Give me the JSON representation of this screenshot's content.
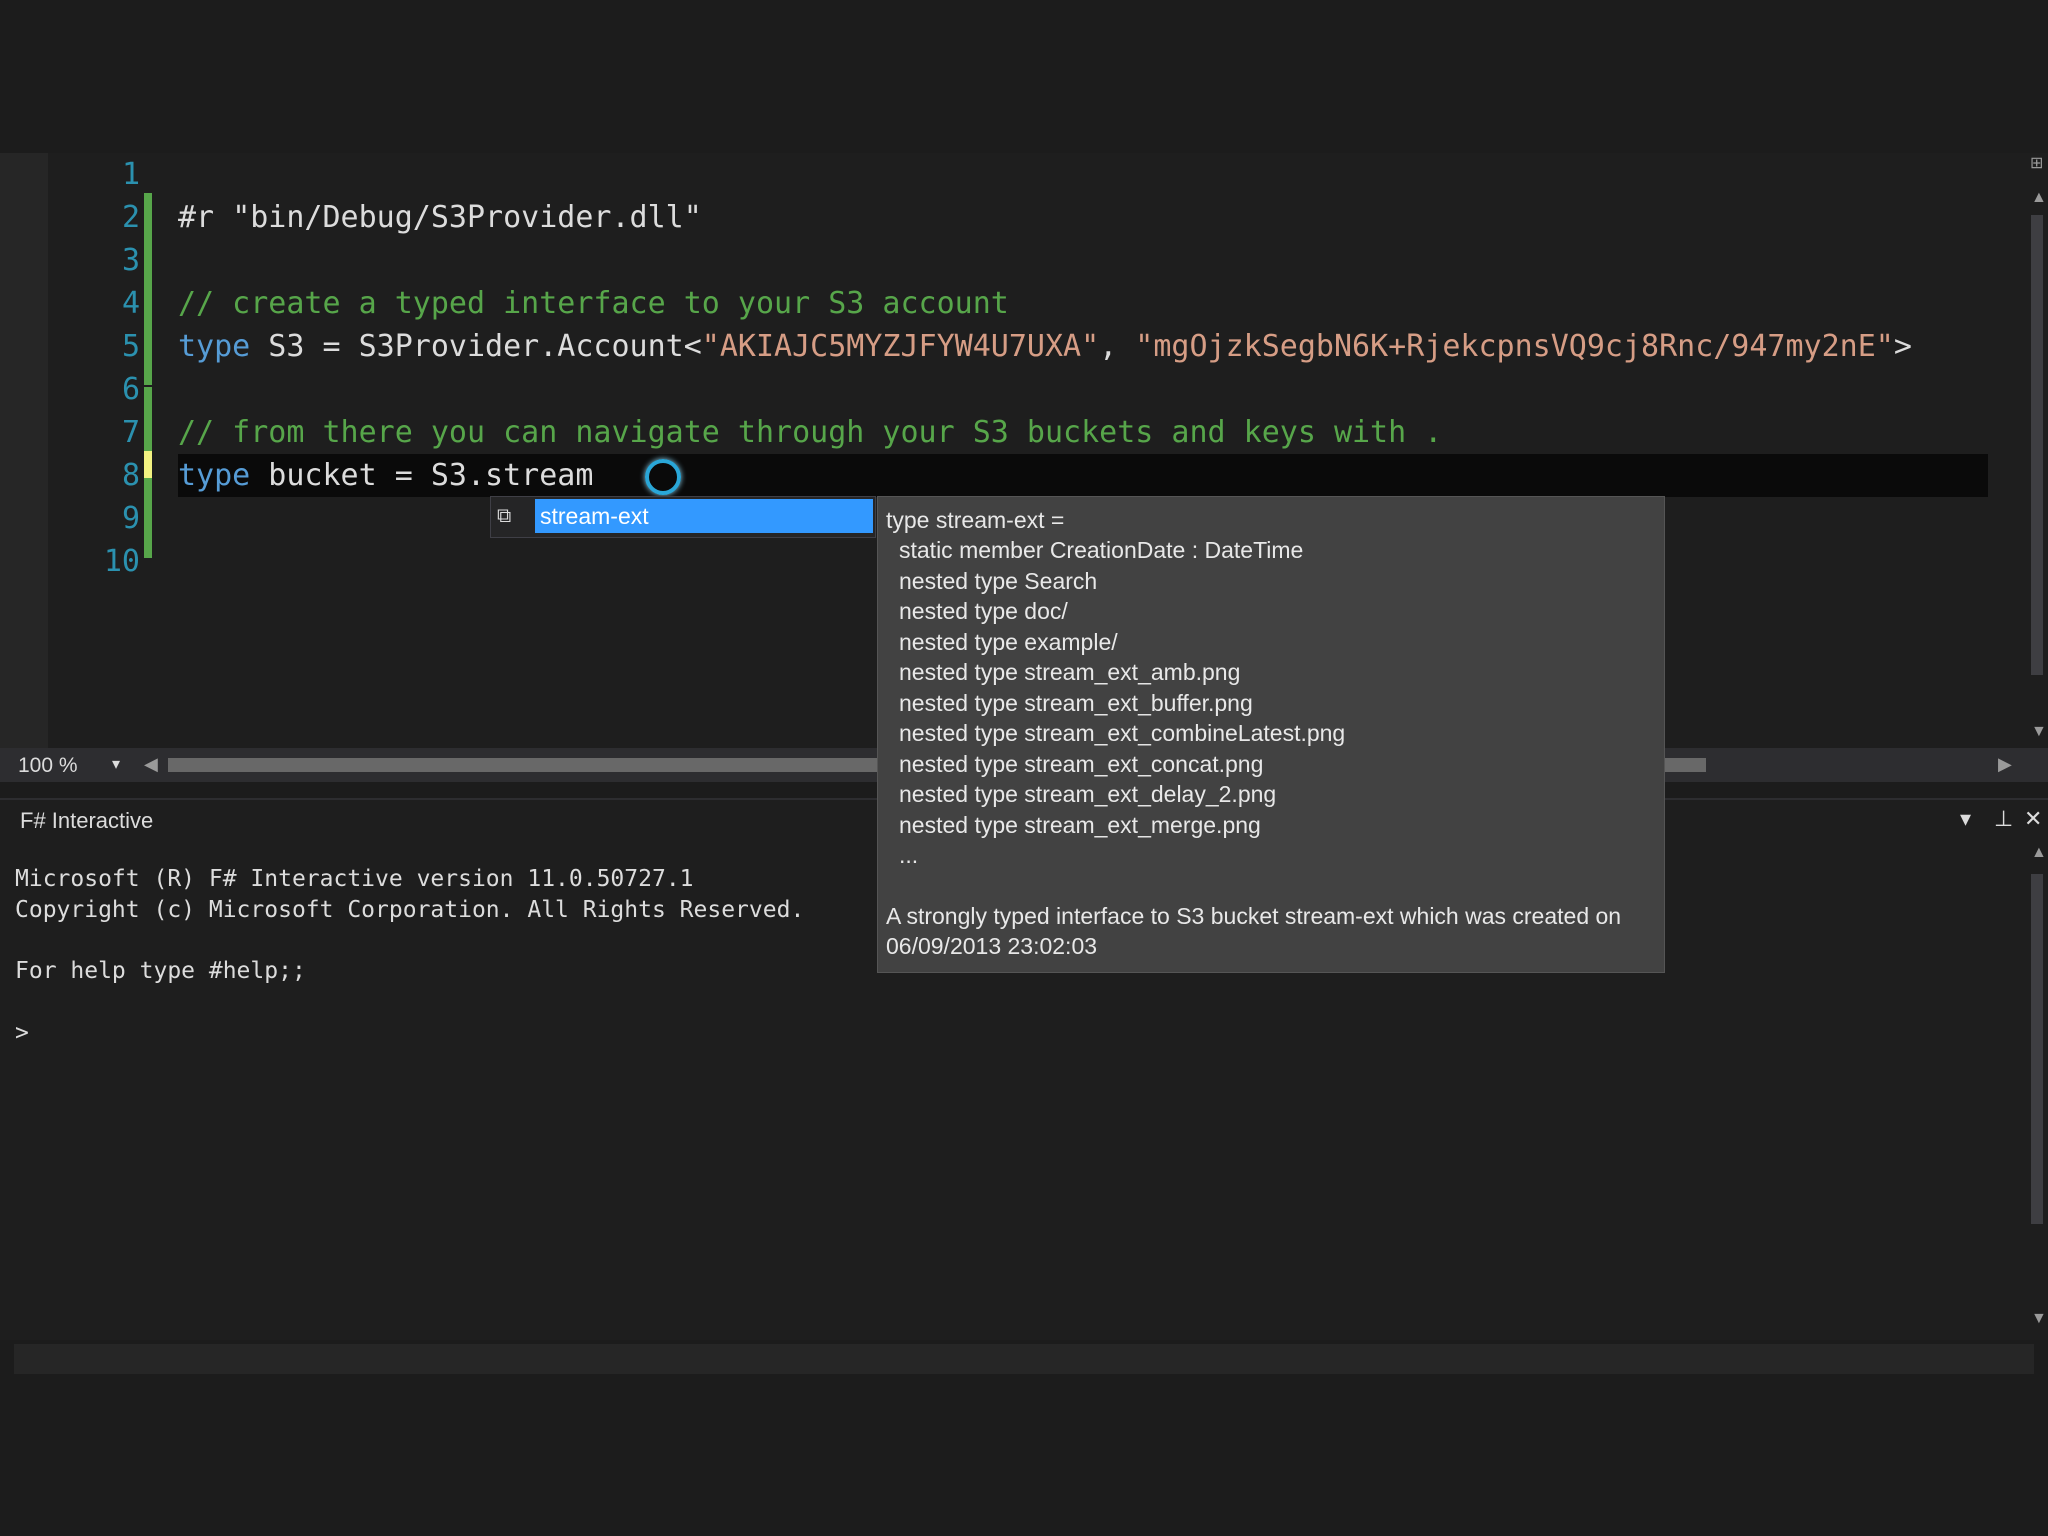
{
  "editor": {
    "line_numbers": [
      "1",
      "2",
      "3",
      "4",
      "5",
      "6",
      "7",
      "8",
      "9",
      "10"
    ],
    "lines": [
      [],
      [
        {
          "t": "#r ",
          "c": ""
        },
        {
          "t": "\"bin/Debug/S3Provider.dll\"",
          "c": ""
        }
      ],
      [],
      [
        {
          "t": "// create a typed interface to your S3 account",
          "c": "cm"
        }
      ],
      [
        {
          "t": "type",
          "c": "kw"
        },
        {
          "t": " S3 = S3Provider.Account<",
          "c": ""
        },
        {
          "t": "\"AKIAJC5MYZJFYW4U7UXA\"",
          "c": "str"
        },
        {
          "t": ", ",
          "c": ""
        },
        {
          "t": "\"mgOjzkSegbN6K+RjekcpnsVQ9cj8Rnc/947my2nE\"",
          "c": "str"
        },
        {
          "t": ">",
          "c": ""
        }
      ],
      [],
      [
        {
          "t": "// from there you can navigate through your S3 buckets and keys with .",
          "c": "cm"
        }
      ],
      [
        {
          "t": "type",
          "c": "kw"
        },
        {
          "t": " bucket = S3.stream",
          "c": ""
        }
      ],
      [],
      []
    ],
    "current_line": 8,
    "zoom": "100 %"
  },
  "completion": {
    "selected_item": "stream-ext"
  },
  "tooltip": {
    "header": "type stream-ext =",
    "members": [
      "static member CreationDate : DateTime",
      "nested type Search",
      "nested type doc/",
      "nested type example/",
      "nested type stream_ext_amb.png",
      "nested type stream_ext_buffer.png",
      "nested type stream_ext_combineLatest.png",
      "nested type stream_ext_concat.png",
      "nested type stream_ext_delay_2.png",
      "nested type stream_ext_merge.png",
      "..."
    ],
    "description": "A strongly typed interface to S3 bucket stream-ext which was created on 06/09/2013 23:02:03"
  },
  "fsi": {
    "title": "F# Interactive",
    "output": [
      "Microsoft (R) F# Interactive version 11.0.50727.1",
      "Copyright (c) Microsoft Corporation. All Rights Reserved.",
      "For help type #help;;",
      ">"
    ]
  },
  "colors": {
    "keyword": "#569cd6",
    "string": "#d69d85",
    "comment": "#57a64a",
    "line_number": "#2b91af",
    "selection": "#3399ff"
  }
}
